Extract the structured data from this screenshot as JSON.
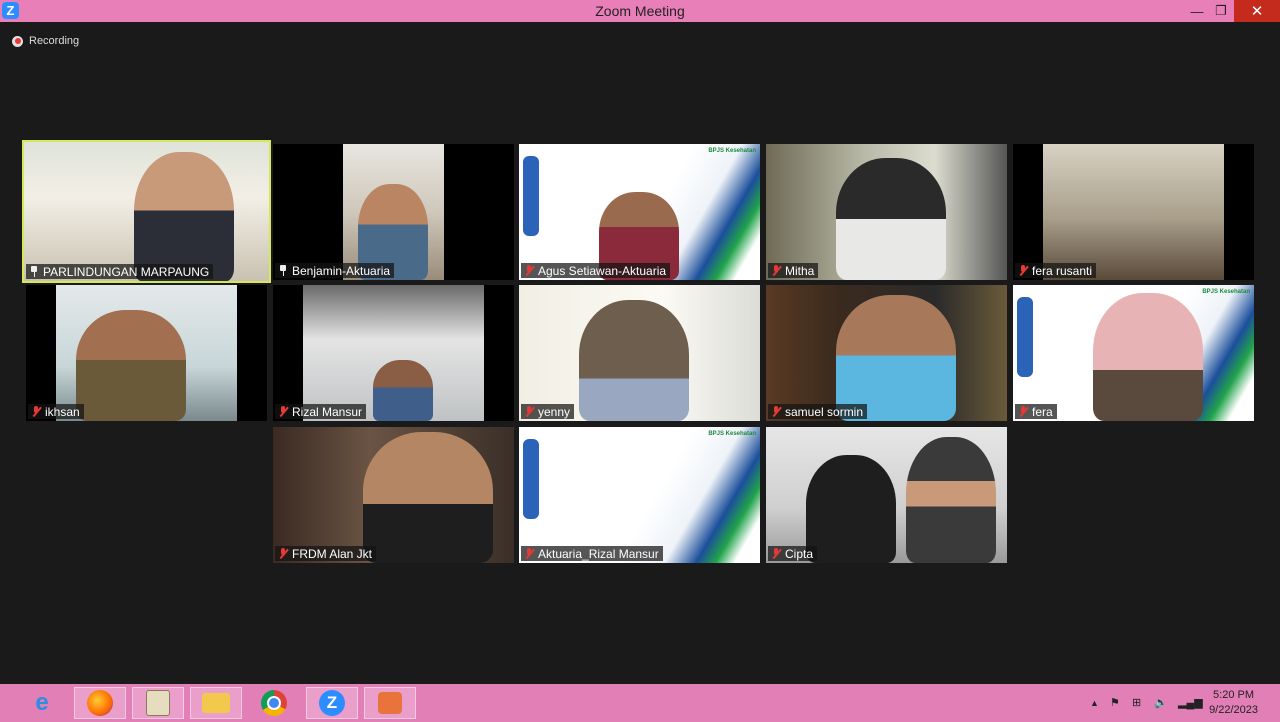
{
  "window": {
    "title": "Zoom Meeting",
    "minimize": "—",
    "maximize": "❐",
    "close": "✕",
    "app_icon": "Z"
  },
  "recording": {
    "label": "Recording"
  },
  "participants": [
    {
      "name": "PARLINDUNGAN MARPAUNG",
      "icon": "pin-icon"
    },
    {
      "name": "Benjamin-Aktuaria",
      "icon": "pin-icon"
    },
    {
      "name": "Agus Setiawan-Aktuaria",
      "icon": "mic-muted-icon"
    },
    {
      "name": "Mitha",
      "icon": "mic-muted-icon"
    },
    {
      "name": "fera rusanti",
      "icon": "mic-muted-icon"
    },
    {
      "name": "ikhsan",
      "icon": "mic-muted-icon"
    },
    {
      "name": "Rizal Mansur",
      "icon": "mic-muted-icon"
    },
    {
      "name": "yenny",
      "icon": "mic-muted-icon"
    },
    {
      "name": "samuel sormin",
      "icon": "mic-muted-icon"
    },
    {
      "name": "fera",
      "icon": "mic-muted-icon"
    },
    {
      "name": "FRDM Alan Jkt",
      "icon": "mic-muted-icon"
    },
    {
      "name": "Aktuaria_Rizal Mansur",
      "icon": "mic-muted-icon"
    },
    {
      "name": "Cipta",
      "icon": "mic-muted-icon"
    }
  ],
  "bpjs_logo": "BPJS Kesehatan",
  "taskbar": {
    "apps": [
      "internet-explorer-icon",
      "firefox-icon",
      "notepad-icon",
      "file-explorer-icon",
      "chrome-icon",
      "zoom-icon",
      "app-icon"
    ],
    "tray_up": "▲",
    "time": "5:20 PM",
    "date": "9/22/2023"
  },
  "colors": {
    "titlebar": "#e87fb8",
    "taskbar": "#e27fb7",
    "active_speaker": "#d6e85a",
    "muted": "#e53935"
  }
}
